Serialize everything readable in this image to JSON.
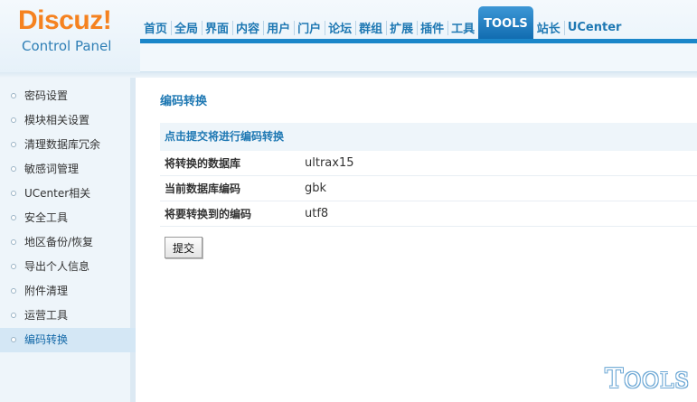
{
  "logo": {
    "word": "Discuz!",
    "subtitle": "Control Panel"
  },
  "nav": {
    "items": [
      {
        "label": "首页"
      },
      {
        "label": "全局"
      },
      {
        "label": "界面"
      },
      {
        "label": "内容"
      },
      {
        "label": "用户"
      },
      {
        "label": "门户"
      },
      {
        "label": "论坛"
      },
      {
        "label": "群组"
      },
      {
        "label": "扩展"
      },
      {
        "label": "插件"
      },
      {
        "label": "工具"
      },
      {
        "label": "TOOLS"
      },
      {
        "label": "站长"
      },
      {
        "label": "UCenter"
      }
    ],
    "active": "TOOLS"
  },
  "sidebar": {
    "items": [
      {
        "label": "密码设置"
      },
      {
        "label": "模块相关设置"
      },
      {
        "label": "清理数据库冗余"
      },
      {
        "label": "敏感词管理"
      },
      {
        "label": "UCenter相关"
      },
      {
        "label": "安全工具"
      },
      {
        "label": "地区备份/恢复"
      },
      {
        "label": "导出个人信息"
      },
      {
        "label": "附件清理"
      },
      {
        "label": "运营工具"
      },
      {
        "label": "编码转换"
      }
    ],
    "active": "编码转换"
  },
  "main": {
    "title": "编码转换",
    "form_header": "点击提交将进行编码转换",
    "rows": [
      {
        "label": "将转换的数据库",
        "value": "ultrax15"
      },
      {
        "label": "当前数据库编码",
        "value": "gbk"
      },
      {
        "label": "将要转换到的编码",
        "value": "utf8"
      }
    ],
    "submit_label": "提交"
  },
  "watermark": {
    "first": "T",
    "rest": "OOLS"
  },
  "colors": {
    "accent": "#1e78b3",
    "logo": "#f58220",
    "active_tab": "#1573b8"
  }
}
